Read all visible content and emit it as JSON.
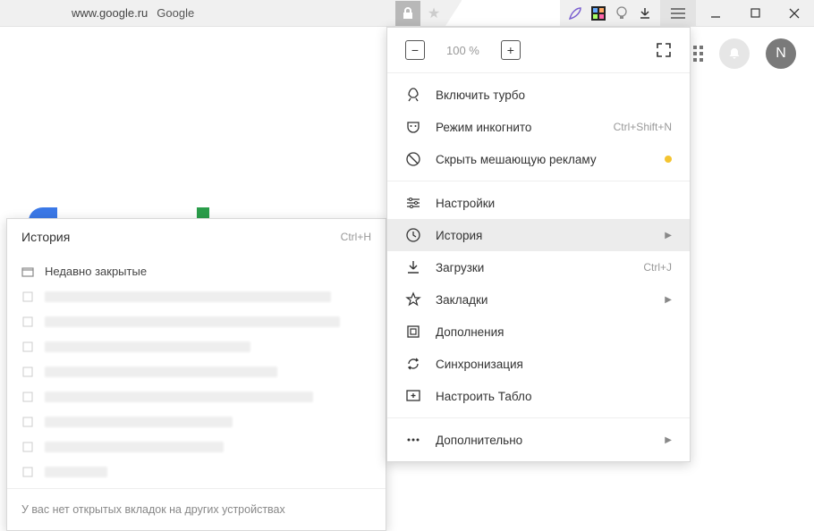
{
  "address": {
    "url": "www.google.ru",
    "title": "Google"
  },
  "zoom": {
    "level": "100 %"
  },
  "avatar": {
    "initial": "N"
  },
  "menu": {
    "turbo": "Включить турбо",
    "incognito": "Режим инкогнито",
    "incognito_shortcut": "Ctrl+Shift+N",
    "hide_ads": "Скрыть мешающую рекламу",
    "settings": "Настройки",
    "history": "История",
    "downloads": "Загрузки",
    "downloads_shortcut": "Ctrl+J",
    "bookmarks": "Закладки",
    "addons": "Дополнения",
    "sync": "Синхронизация",
    "customize_tablo": "Настроить Табло",
    "more": "Дополнительно"
  },
  "history_panel": {
    "title": "История",
    "shortcut": "Ctrl+H",
    "recently_closed": "Недавно закрытые",
    "footer": "У вас нет открытых вкладок на других устройствах"
  }
}
